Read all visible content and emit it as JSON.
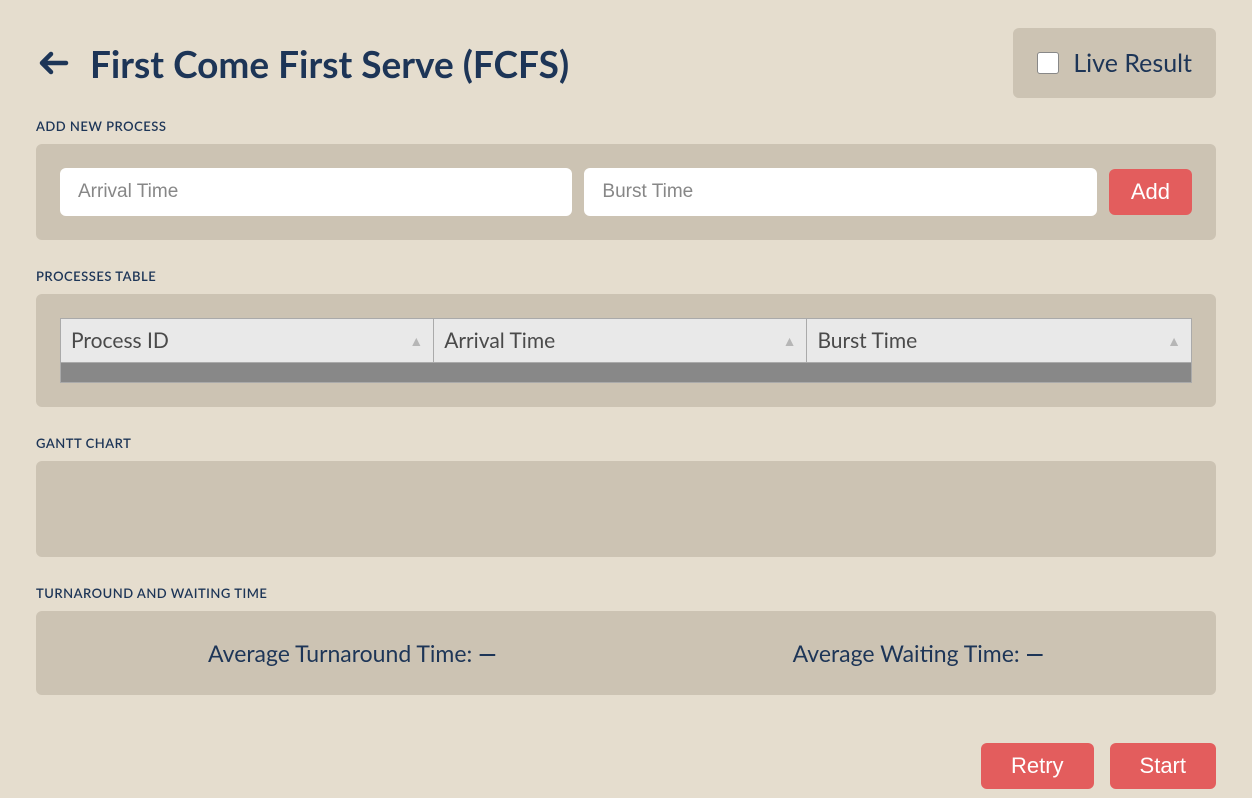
{
  "header": {
    "title": "First Come First Serve (FCFS)",
    "live_result_label": "Live Result"
  },
  "sections": {
    "add_new": {
      "label": "ADD NEW PROCESS",
      "arrival_placeholder": "Arrival Time",
      "burst_placeholder": "Burst Time",
      "add_button": "Add"
    },
    "processes_table": {
      "label": "PROCESSES TABLE",
      "columns": {
        "process_id": "Process ID",
        "arrival_time": "Arrival Time",
        "burst_time": "Burst Time"
      }
    },
    "gantt_chart": {
      "label": "GANTT CHART"
    },
    "turnaround": {
      "label": "TURNAROUND AND WAITING TIME",
      "avg_turnaround_label": "Average Turnaround Time:",
      "avg_turnaround_value": "—",
      "avg_waiting_label": "Average Waiting Time:",
      "avg_waiting_value": "—"
    }
  },
  "footer": {
    "retry": "Retry",
    "start": "Start"
  }
}
